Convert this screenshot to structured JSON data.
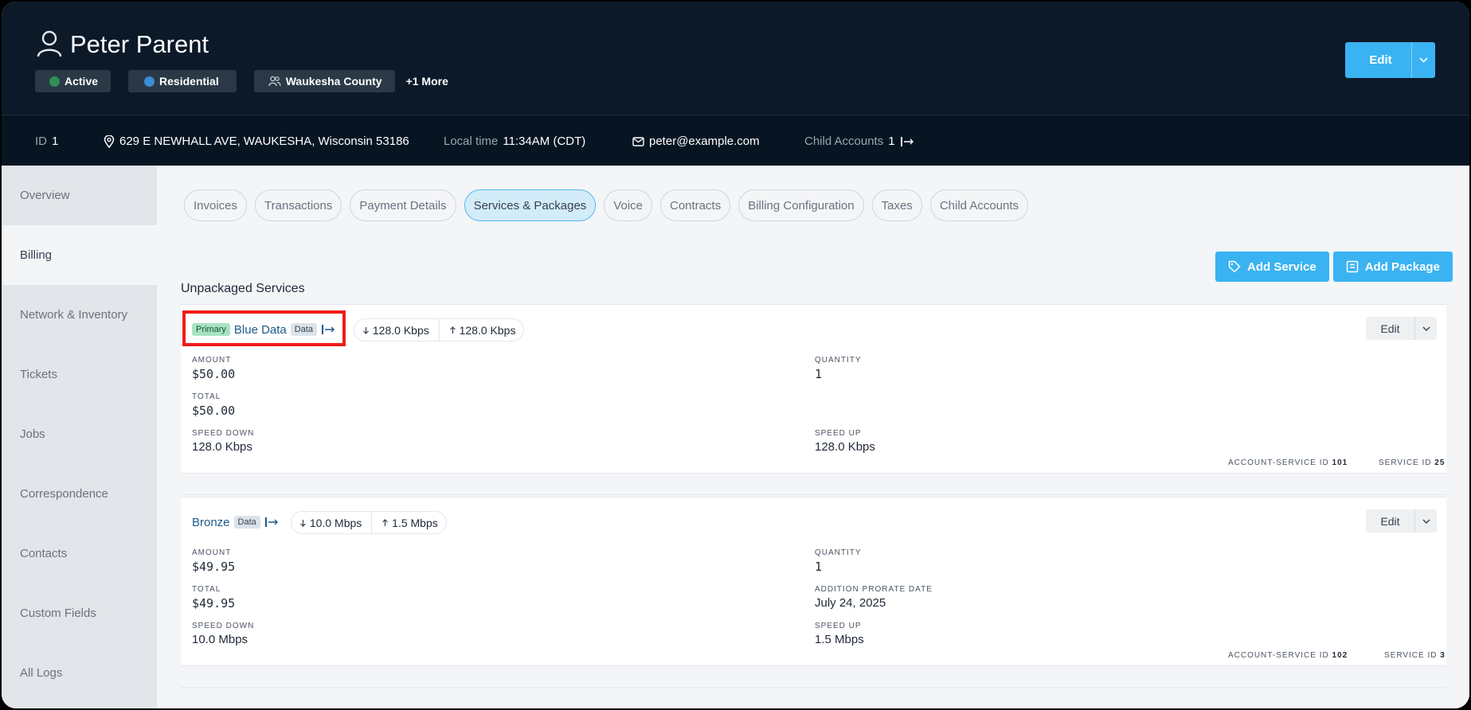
{
  "header": {
    "user_name": "Peter Parent",
    "badges": {
      "active": "Active",
      "residential": "Residential",
      "county": "Waukesha County",
      "more": "+1 More"
    },
    "edit_label": "Edit",
    "colors": {
      "active_dot": "#2f8f57",
      "residential_dot": "#3a8dd6"
    }
  },
  "info": {
    "id_label": "ID",
    "id_value": "1",
    "address": "629 E NEWHALL AVE, WAUKESHA, Wisconsin 53186",
    "local_time_label": "Local time",
    "local_time_value": "11:34AM (CDT)",
    "email": "peter@example.com",
    "child_accounts_label": "Child Accounts",
    "child_accounts_value": "1"
  },
  "sidebar": {
    "items": [
      {
        "label": "Overview"
      },
      {
        "label": "Billing"
      },
      {
        "label": "Network & Inventory"
      },
      {
        "label": "Tickets"
      },
      {
        "label": "Jobs"
      },
      {
        "label": "Correspondence"
      },
      {
        "label": "Contacts"
      },
      {
        "label": "Custom Fields"
      },
      {
        "label": "All Logs"
      }
    ],
    "active": "Billing"
  },
  "tabs": [
    {
      "label": "Invoices"
    },
    {
      "label": "Transactions"
    },
    {
      "label": "Payment Details"
    },
    {
      "label": "Services & Packages"
    },
    {
      "label": "Voice"
    },
    {
      "label": "Contracts"
    },
    {
      "label": "Billing Configuration"
    },
    {
      "label": "Taxes"
    },
    {
      "label": "Child Accounts"
    }
  ],
  "actions": {
    "add_service": "Add Service",
    "add_package": "Add Package"
  },
  "section_title": "Unpackaged Services",
  "services": [
    {
      "primary_tag": "Primary",
      "name": "Blue Data",
      "type_tag": "Data",
      "speed_down": "128.0 Kbps",
      "speed_up": "128.0 Kbps",
      "edit_label": "Edit",
      "amount_label": "AMOUNT",
      "amount": "$50.00",
      "quantity_label": "QUANTITY",
      "quantity": "1",
      "total_label": "TOTAL",
      "total": "$50.00",
      "speed_down_label": "SPEED DOWN",
      "speed_down_val": "128.0 Kbps",
      "speed_up_label": "SPEED UP",
      "speed_up_val": "128.0 Kbps",
      "acct_service_id_label": "ACCOUNT-SERVICE ID",
      "acct_service_id": "101",
      "service_id_label": "SERVICE ID",
      "service_id": "25"
    },
    {
      "name": "Bronze",
      "type_tag": "Data",
      "speed_down": "10.0 Mbps",
      "speed_up": "1.5 Mbps",
      "edit_label": "Edit",
      "amount_label": "AMOUNT",
      "amount": "$49.95",
      "quantity_label": "QUANTITY",
      "quantity": "1",
      "total_label": "TOTAL",
      "total": "$49.95",
      "prorate_label": "ADDITION PRORATE DATE",
      "prorate": "July 24, 2025",
      "speed_down_label": "SPEED DOWN",
      "speed_down_val": "10.0 Mbps",
      "speed_up_label": "SPEED UP",
      "speed_up_val": "1.5 Mbps",
      "acct_service_id_label": "ACCOUNT-SERVICE ID",
      "acct_service_id": "102",
      "service_id_label": "SERVICE ID",
      "service_id": "3"
    }
  ],
  "icons": {
    "user": "user-icon",
    "location": "map-pin-icon",
    "mail": "mail-icon",
    "arrow": "arrow-right-to-bar-icon",
    "tag": "tag-icon",
    "package": "package-icon",
    "down": "arrow-down-icon",
    "up": "arrow-up-icon",
    "chevron": "chevron-down-icon"
  }
}
